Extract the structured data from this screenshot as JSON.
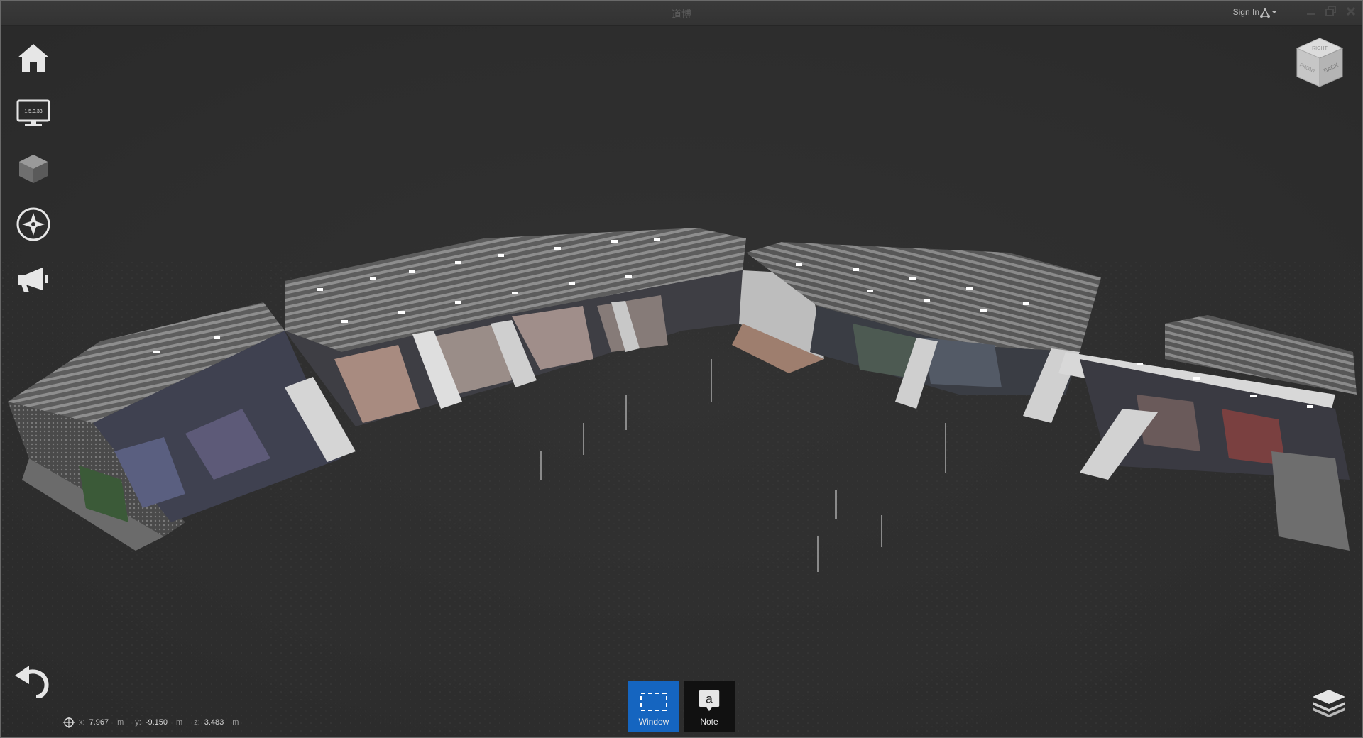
{
  "window": {
    "title": "道博",
    "sign_in": "Sign In"
  },
  "sidebar": {
    "items": [
      {
        "name": "home",
        "icon": "home-icon"
      },
      {
        "name": "display",
        "icon": "monitor-icon",
        "badge": "1.5.0.33"
      },
      {
        "name": "model",
        "icon": "cube-icon"
      },
      {
        "name": "navigation",
        "icon": "compass-icon"
      },
      {
        "name": "announce",
        "icon": "megaphone-icon"
      }
    ]
  },
  "viewcube": {
    "faces": [
      "RIGHT",
      "FRONT",
      "BACK"
    ]
  },
  "toolbar": {
    "window_label": "Window",
    "note_label": "Note",
    "note_glyph": "a",
    "active_color": "#1565c0"
  },
  "coords": {
    "x_label": "x:",
    "x": "7.967",
    "x_unit": "m",
    "y_label": "y:",
    "y": "-9.150",
    "y_unit": "m",
    "z_label": "z:",
    "z": "3.483",
    "z_unit": "m"
  },
  "colors": {
    "background": "#2f2f2f",
    "titlebar": "#363636",
    "icon": "#e6e6e6"
  }
}
